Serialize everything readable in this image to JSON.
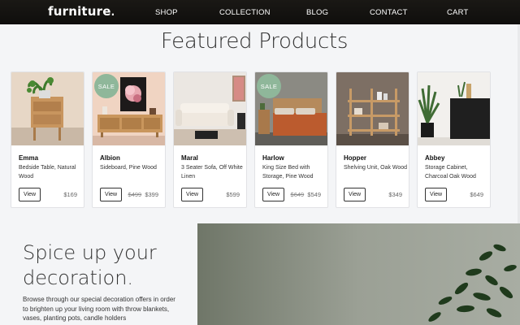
{
  "brand": {
    "name": "furniture",
    "mark": "."
  },
  "nav": {
    "items": [
      "SHOP",
      "COLLECTION",
      "BLOG",
      "CONTACT",
      "CART"
    ]
  },
  "featured": {
    "title": "Featured Products"
  },
  "products": [
    {
      "name": "Emma",
      "desc": "Bedside Table, Natural Wood",
      "view": "View",
      "old_price": "",
      "price": "$169",
      "sale": ""
    },
    {
      "name": "Albion",
      "desc": "Sideboard, Pine Wood",
      "view": "View",
      "old_price": "$499",
      "price": "$399",
      "sale": "SALE"
    },
    {
      "name": "Maral",
      "desc": "3 Seater Sofa, Off White Linen",
      "view": "View",
      "old_price": "",
      "price": "$599",
      "sale": ""
    },
    {
      "name": "Harlow",
      "desc": "King Size Bed with Storage, Pine Wood",
      "view": "View",
      "old_price": "$649",
      "price": "$549",
      "sale": "SALE"
    },
    {
      "name": "Hopper",
      "desc": "Shelving Unit, Oak Wood",
      "view": "View",
      "old_price": "",
      "price": "$349",
      "sale": ""
    },
    {
      "name": "Abbey",
      "desc": "Storage Cabinet, Charcoal Oak Wood",
      "view": "View",
      "old_price": "",
      "price": "$649",
      "sale": ""
    }
  ],
  "promo": {
    "heading_line1": "Spice up your",
    "heading_line2": "decoration.",
    "body": "Browse through our special decoration offers in order to brighten up your living room with throw blankets, vases, planting pots, candle holders"
  },
  "colors": {
    "nav_bg": "#13110f",
    "sale_badge": "#8fb79a",
    "page_bg": "#f4f5f7"
  }
}
